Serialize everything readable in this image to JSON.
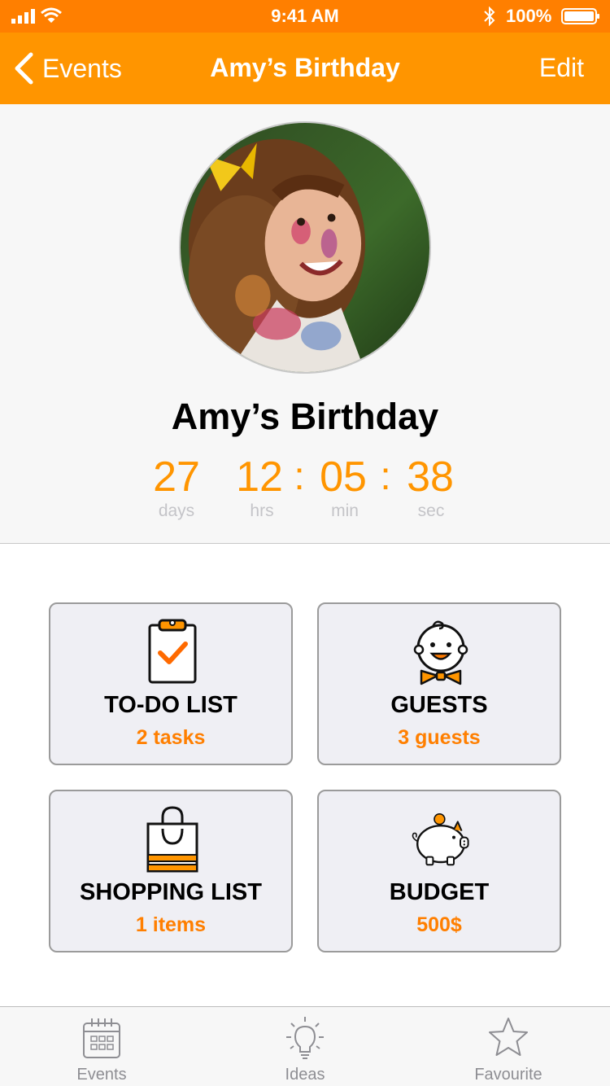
{
  "status_bar": {
    "time": "9:41 AM",
    "battery": "100%",
    "icons": [
      "signal-icon",
      "wifi-icon",
      "bluetooth-icon",
      "battery-icon"
    ]
  },
  "nav": {
    "back_label": "Events",
    "title": "Amy’s Birthday",
    "edit_label": "Edit"
  },
  "event": {
    "title": "Amy’s Birthday",
    "photo": "girl-portrait",
    "countdown": {
      "days": "27",
      "hours": "12",
      "minutes": "05",
      "seconds": "38",
      "separator": ":",
      "days_label": "days",
      "hours_label": "hrs",
      "minutes_label": "min",
      "seconds_label": "sec"
    }
  },
  "cards": [
    {
      "title": "TO-DO LIST",
      "subtitle": "2 tasks",
      "icon": "clipboard-check-icon"
    },
    {
      "title": "GUESTS",
      "subtitle": "3 guests",
      "icon": "baby-face-icon"
    },
    {
      "title": "SHOPPING LIST",
      "subtitle": "1 items",
      "icon": "shopping-bag-icon"
    },
    {
      "title": "BUDGET",
      "subtitle": "500$",
      "icon": "piggy-bank-icon"
    }
  ],
  "tabs": [
    {
      "label": "Events",
      "icon": "calendar-icon"
    },
    {
      "label": "Ideas",
      "icon": "lightbulb-icon"
    },
    {
      "label": "Favourite",
      "icon": "star-icon"
    }
  ],
  "colors": {
    "status_bar": "#ff7f00",
    "nav_bar": "#ff9500",
    "accent": "#ff9500",
    "subtitle": "#ff7f00",
    "card_bg": "#efeff4",
    "tab_inactive": "#8e8e93"
  }
}
